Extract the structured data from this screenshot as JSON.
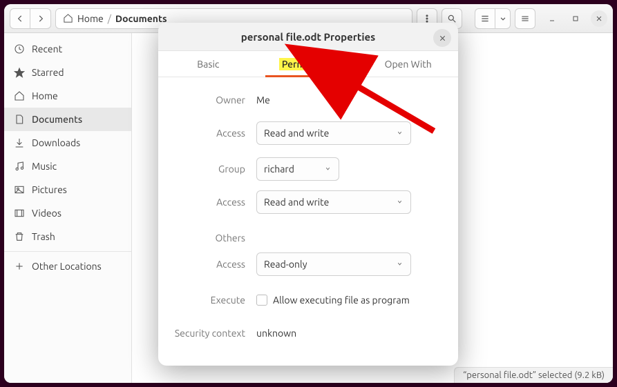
{
  "header": {
    "home_label": "Home",
    "path_current": "Documents"
  },
  "sidebar": {
    "items": [
      {
        "label": "Recent"
      },
      {
        "label": "Starred"
      },
      {
        "label": "Home"
      },
      {
        "label": "Documents"
      },
      {
        "label": "Downloads"
      },
      {
        "label": "Music"
      },
      {
        "label": "Pictures"
      },
      {
        "label": "Videos"
      },
      {
        "label": "Trash"
      }
    ],
    "other_locations": "Other Locations"
  },
  "statusbar": {
    "text": "“personal file.odt” selected  (9.2 kB)"
  },
  "dialog": {
    "title": "personal file.odt Properties",
    "tabs": {
      "basic": "Basic",
      "permissions": "Permissions",
      "openwith": "Open With"
    },
    "labels": {
      "owner": "Owner",
      "access": "Access",
      "group": "Group",
      "others": "Others",
      "execute": "Execute",
      "security": "Security context"
    },
    "values": {
      "owner": "Me",
      "owner_access": "Read and write",
      "group": "richard",
      "group_access": "Read and write",
      "others_access": "Read-only",
      "execute_label": "Allow executing file as program",
      "security": "unknown"
    }
  }
}
